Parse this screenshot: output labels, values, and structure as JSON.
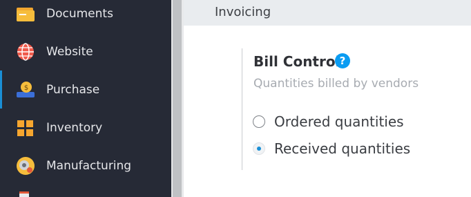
{
  "sidebar": {
    "items": [
      {
        "label": "Documents",
        "icon": "documents-icon"
      },
      {
        "label": "Website",
        "icon": "website-icon"
      },
      {
        "label": "Purchase",
        "icon": "purchase-icon",
        "active": true
      },
      {
        "label": "Inventory",
        "icon": "inventory-icon"
      },
      {
        "label": "Manufacturing",
        "icon": "manufacturing-icon"
      }
    ]
  },
  "section": {
    "title": "Invoicing"
  },
  "setting": {
    "title": "Bill Control",
    "help_icon": "?",
    "description": "Quantities billed by vendors",
    "options": [
      {
        "label": "Ordered quantities",
        "selected": false
      },
      {
        "label": "Received quantities",
        "selected": true
      }
    ]
  },
  "colors": {
    "sidebar_bg": "#262a36",
    "accent": "#1a8fd6",
    "help": "#0a9cf2"
  }
}
